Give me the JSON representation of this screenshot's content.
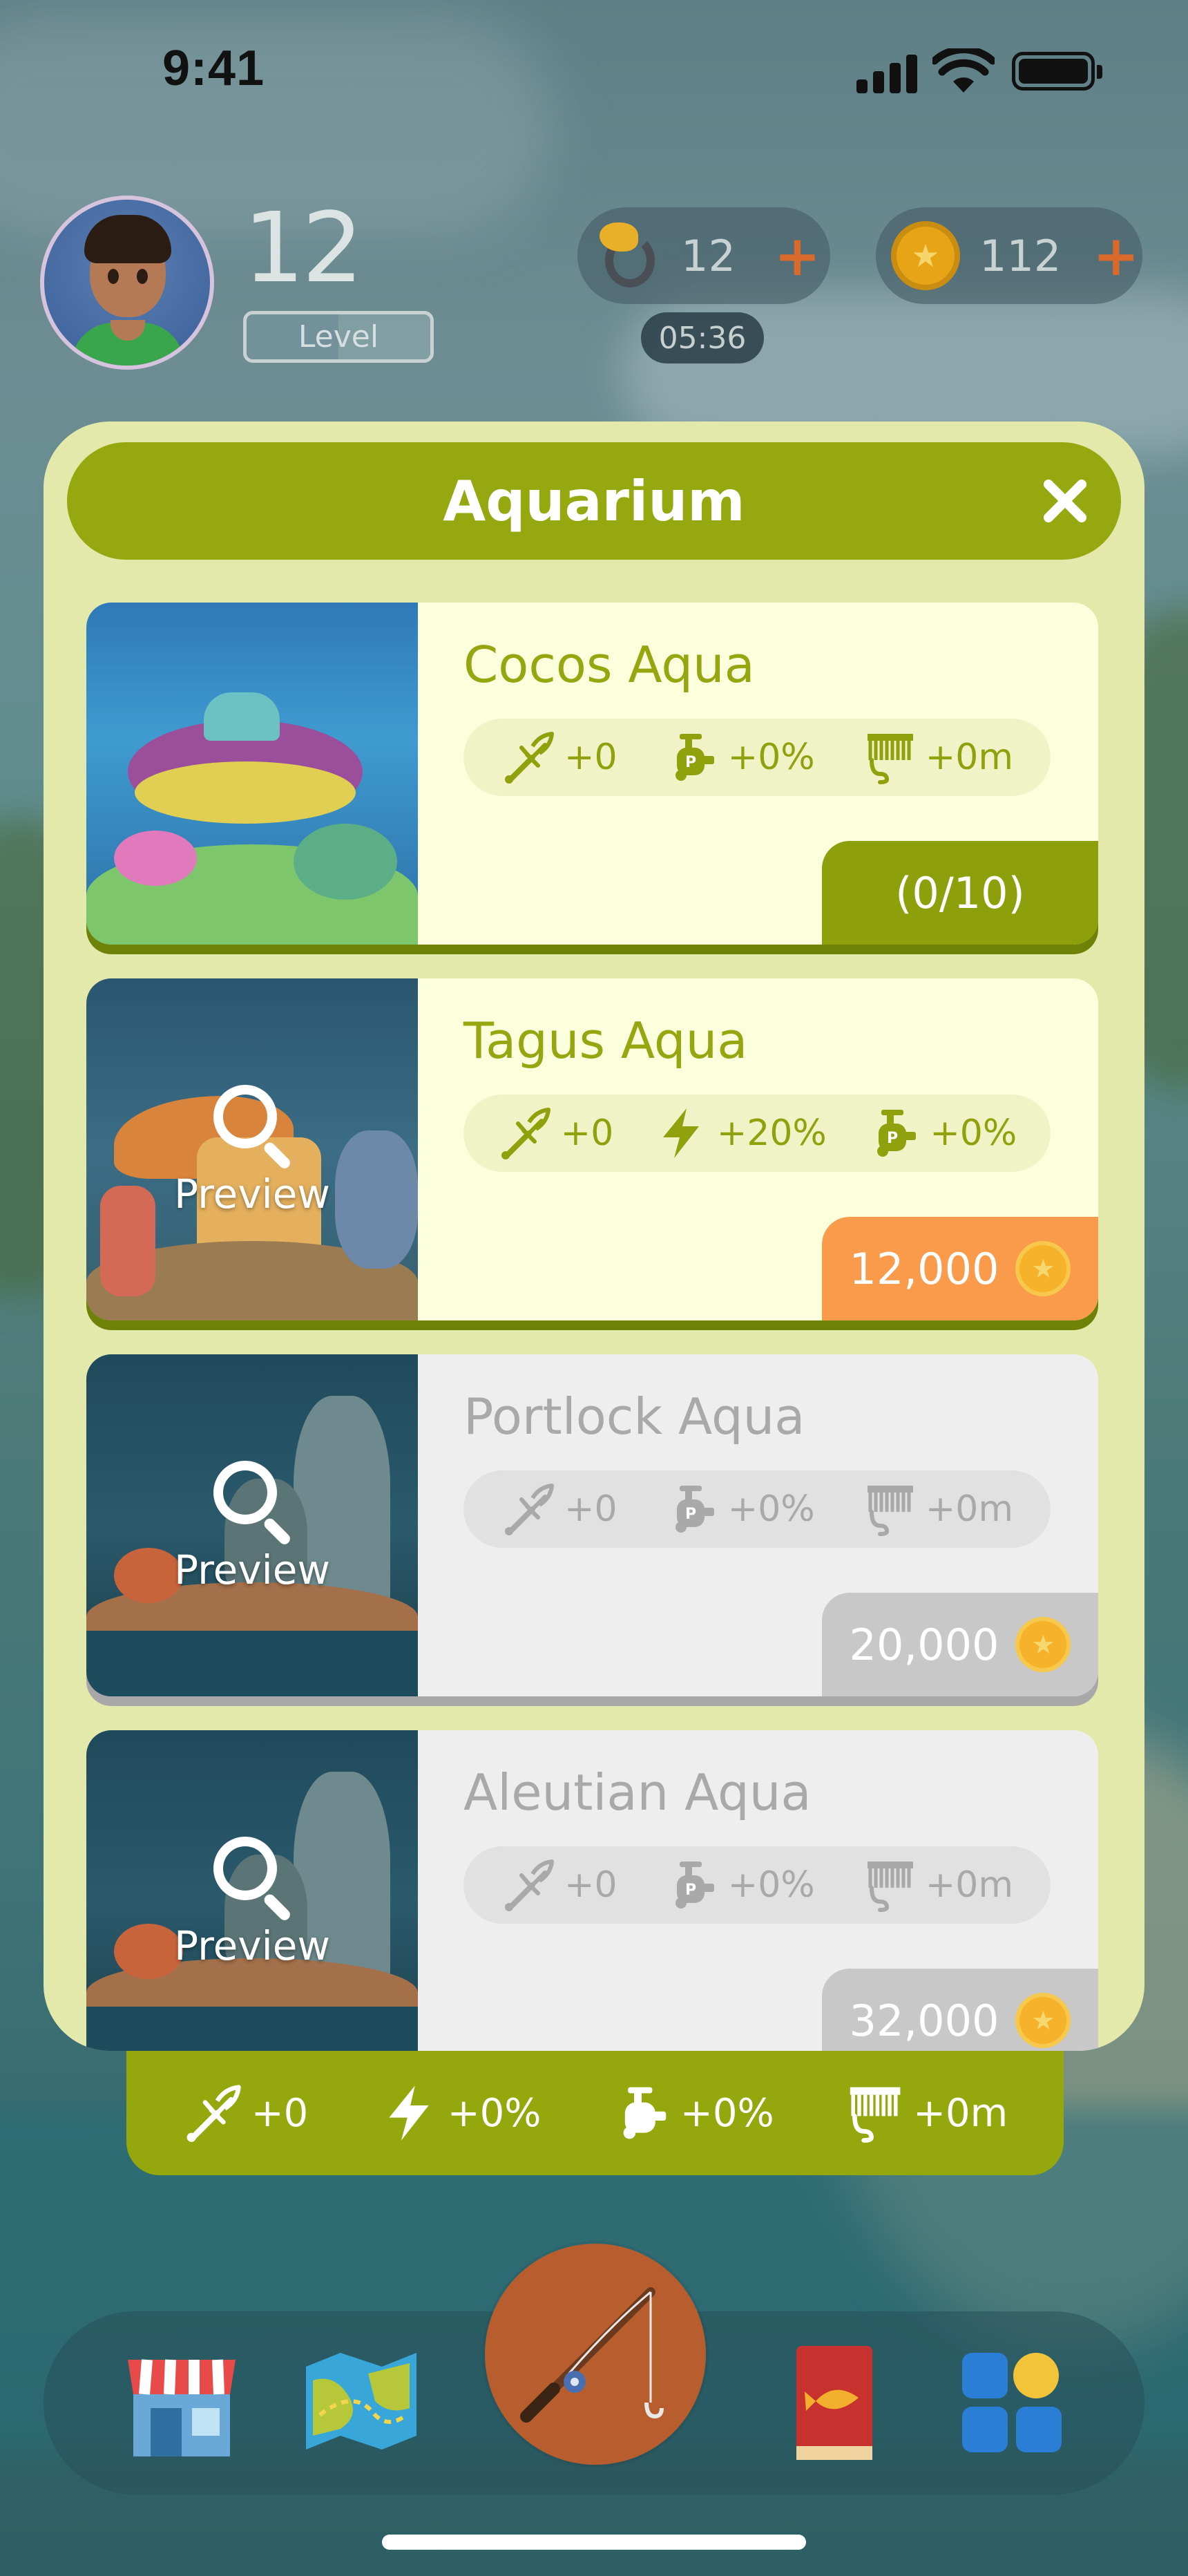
{
  "status_bar": {
    "time": "9:41"
  },
  "player": {
    "level": "12",
    "level_label": "Level",
    "level_progress": 0.5
  },
  "resources": {
    "bait": {
      "count": "12",
      "plus": "+",
      "timer": "05:36",
      "icon": "bait-hook-icon"
    },
    "coins": {
      "count": "112",
      "plus": "+",
      "icon": "coin-icon"
    }
  },
  "panel": {
    "title": "Aquarium",
    "close_icon": "close-icon",
    "cards": [
      {
        "name": "Cocos Aqua",
        "state": "owned",
        "stats": [
          {
            "icon": "trident-icon",
            "value": "+0"
          },
          {
            "icon": "bait-pump-icon",
            "value": "+0%"
          },
          {
            "icon": "reel-icon",
            "value": "+0m"
          }
        ],
        "action": "(0/10)"
      },
      {
        "name": "Tagus Aqua",
        "state": "buy",
        "preview": "Preview",
        "stats": [
          {
            "icon": "trident-icon",
            "value": "+0"
          },
          {
            "icon": "lightning-icon",
            "value": "+20%"
          },
          {
            "icon": "bait-pump-icon",
            "value": "+0%"
          }
        ],
        "action": "12,000"
      },
      {
        "name": "Portlock Aqua",
        "state": "locked",
        "preview": "Preview",
        "stats": [
          {
            "icon": "trident-icon",
            "value": "+0"
          },
          {
            "icon": "bait-pump-icon",
            "value": "+0%"
          },
          {
            "icon": "reel-icon",
            "value": "+0m"
          }
        ],
        "action": "20,000"
      },
      {
        "name": "Aleutian Aqua",
        "state": "locked",
        "preview": "Preview",
        "stats": [
          {
            "icon": "trident-icon",
            "value": "+0"
          },
          {
            "icon": "bait-pump-icon",
            "value": "+0%"
          },
          {
            "icon": "reel-icon",
            "value": "+0m"
          }
        ],
        "action": "32,000"
      }
    ]
  },
  "bonus_bar": [
    {
      "icon": "trident-icon",
      "value": "+0"
    },
    {
      "icon": "lightning-icon",
      "value": "+0%"
    },
    {
      "icon": "bait-pump-icon",
      "value": "+0%"
    },
    {
      "icon": "reel-icon",
      "value": "+0m"
    }
  ],
  "bottom_nav": [
    {
      "icon": "shop-icon"
    },
    {
      "icon": "map-icon"
    },
    {
      "icon": "fishing-rod-icon"
    },
    {
      "icon": "fish-book-icon"
    },
    {
      "icon": "apps-icon"
    }
  ],
  "colors": {
    "accent": "#95a80f",
    "buy": "#f99b4b",
    "panel_bg": "#e3e8ab"
  }
}
